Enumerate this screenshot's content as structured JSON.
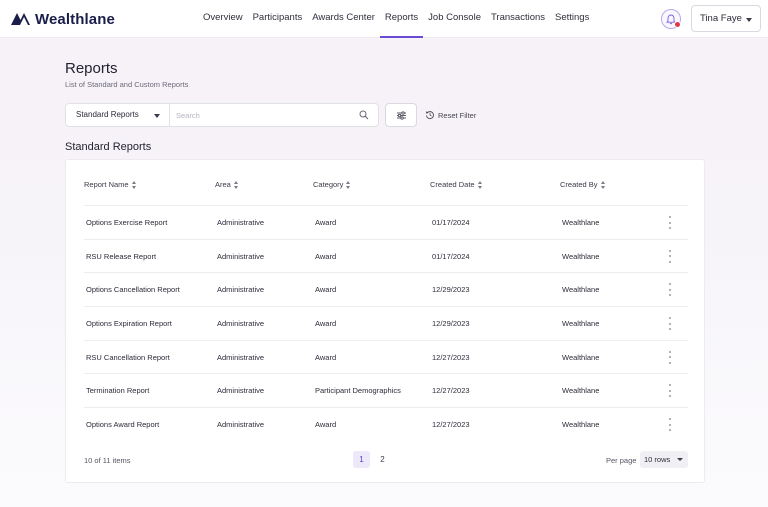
{
  "brand": {
    "name": "Wealthlane",
    "accent": "#6b4ad6",
    "logo_color": "#1b1e4b"
  },
  "nav": {
    "items": [
      {
        "label": "Overview",
        "active": false
      },
      {
        "label": "Participants",
        "active": false
      },
      {
        "label": "Awards Center",
        "active": false
      },
      {
        "label": "Reports",
        "active": true
      },
      {
        "label": "Job Console",
        "active": false
      },
      {
        "label": "Transactions",
        "active": false
      },
      {
        "label": "Settings",
        "active": false
      }
    ]
  },
  "header": {
    "notification_icon": "bell-icon",
    "user_name": "Tina Faye"
  },
  "page": {
    "title": "Reports",
    "subtitle": "List of Standard and Custom Reports"
  },
  "filters": {
    "report_type": "Standard Reports",
    "search_placeholder": "Search",
    "search_value": "",
    "reset_label": "Reset Filter"
  },
  "section": {
    "title": "Standard Reports"
  },
  "table": {
    "columns": [
      "Report Name",
      "Area",
      "Category",
      "Created Date",
      "Created By"
    ],
    "rows": [
      [
        "Options Exercise Report",
        "Administrative",
        "Award",
        "01/17/2024",
        "Wealthlane"
      ],
      [
        "RSU Release Report",
        "Administrative",
        "Award",
        "01/17/2024",
        "Wealthlane"
      ],
      [
        "Options Cancellation Report",
        "Administrative",
        "Award",
        "12/29/2023",
        "Wealthlane"
      ],
      [
        "Options Expiration Report",
        "Administrative",
        "Award",
        "12/29/2023",
        "Wealthlane"
      ],
      [
        "RSU Cancellation Report",
        "Administrative",
        "Award",
        "12/27/2023",
        "Wealthlane"
      ],
      [
        "Termination Report",
        "Administrative",
        "Participant Demographics",
        "12/27/2023",
        "Wealthlane"
      ],
      [
        "Options Award Report",
        "Administrative",
        "Award",
        "12/27/2023",
        "Wealthlane"
      ]
    ]
  },
  "pagination": {
    "items_text": "10 of 11 items",
    "pages": [
      "1",
      "2"
    ],
    "current_page": "1",
    "per_page_label": "Per page",
    "per_page_value": "10 rows"
  }
}
